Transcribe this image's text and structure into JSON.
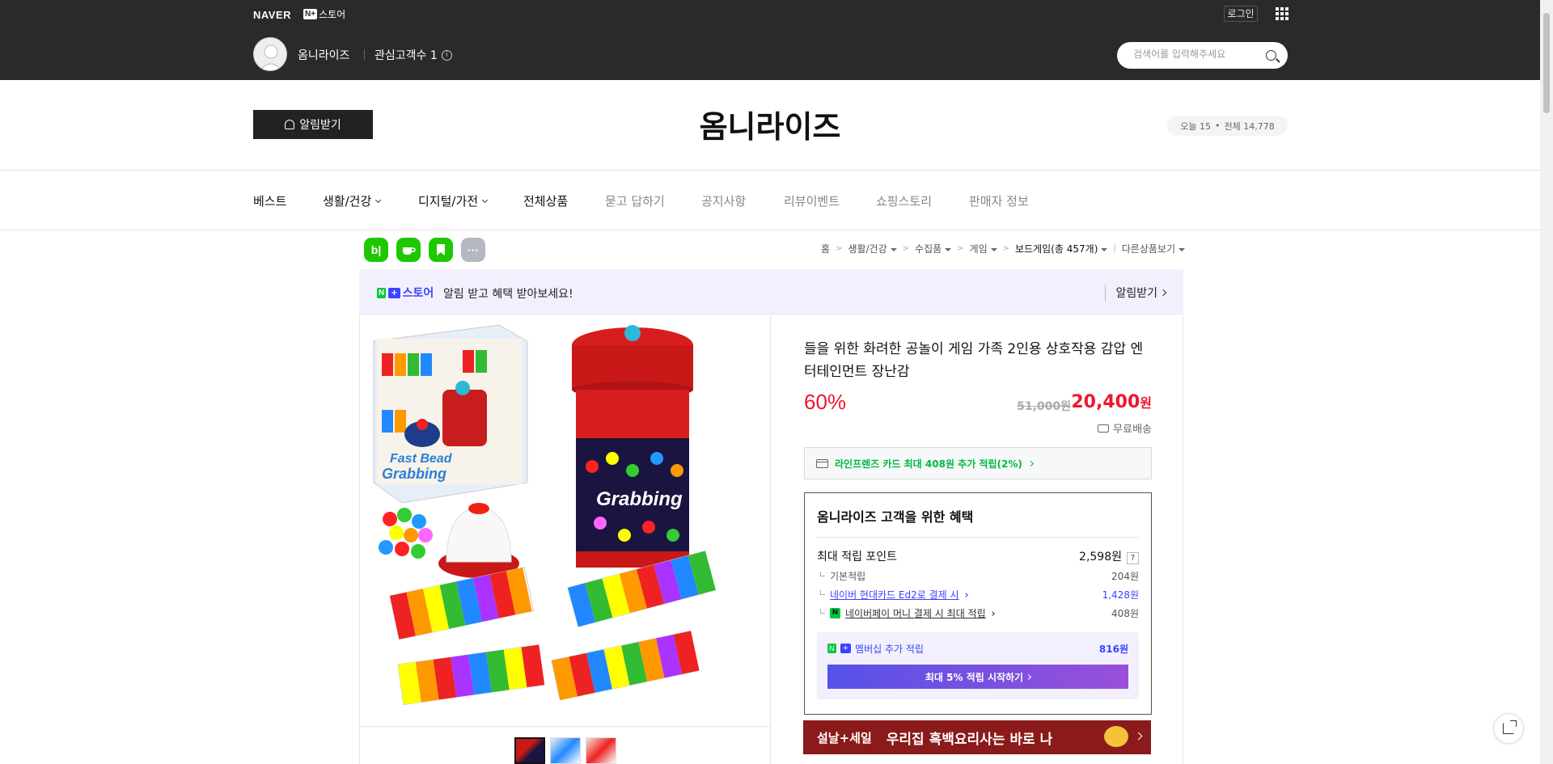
{
  "topbar": {
    "naver": "NAVER",
    "nplus_badge": "N+",
    "store_brand": "스토어",
    "login": "로그인",
    "store_name": "옴니라이즈",
    "follower_label": "관심고객수 1",
    "search_placeholder": "검색어를 입력해주세요"
  },
  "header": {
    "alarm_button": "알림받기",
    "title": "옴니라이즈",
    "visitors_today": "오늘 15",
    "visitors_total": "전체 14,778"
  },
  "nav": {
    "items": [
      "베스트",
      "생활/건강",
      "디지털/가전",
      "전체상품",
      "묻고 답하기",
      "공지사항",
      "리뷰이벤트",
      "쇼핑스토리",
      "판매자 정보"
    ]
  },
  "quick_icons": [
    "b|",
    "",
    "",
    "···"
  ],
  "breadcrumb": {
    "home": "홈",
    "c1": "생활/건강",
    "c2": "수집품",
    "c3": "게임",
    "c4": "보드게임(총 457개)",
    "other": "다른상품보기"
  },
  "banner": {
    "logo_text": "스토어",
    "message": "알림 받고 혜택 받아보세요!",
    "action": "알림받기"
  },
  "product": {
    "title": "들을 위한 화려한 공놀이 게임 가족 2인용 상호작용 감압 엔터테인먼트 장난감",
    "discount": "60%",
    "original_price": "51,000원",
    "sale_price": "20,400",
    "sale_unit": "원",
    "shipping": "무료배송",
    "card_benefit": "라인프렌즈 카드 최대 408원 추가 적립(2%)"
  },
  "benefit": {
    "title": "옴니라이즈 고객을 위한 혜택",
    "max_point_label": "최대 적립 포인트",
    "max_point_value": "2,598원",
    "basic_label": "기본적립",
    "basic_value": "204원",
    "card_label": "네이버 현대카드 Ed2로 결제 시",
    "card_value": "1,428원",
    "npay_label": "네이버페이 머니 결제 시 최대 적립",
    "npay_value": "408원",
    "membership_label": "멤버십 추가 적립",
    "membership_value": "816원",
    "membership_button": "최대 5% 적립 시작하기"
  },
  "promo": {
    "tag": "설날+세일",
    "text": "우리집 흑백요리사는 바로 나"
  },
  "product_image": {
    "brand_text_1": "Fast Bead",
    "brand_text_2": "Grabbing"
  },
  "colors": {
    "accent_red": "#f0152d",
    "naver_green": "#00c73c",
    "plus_blue": "#3a43ff"
  }
}
